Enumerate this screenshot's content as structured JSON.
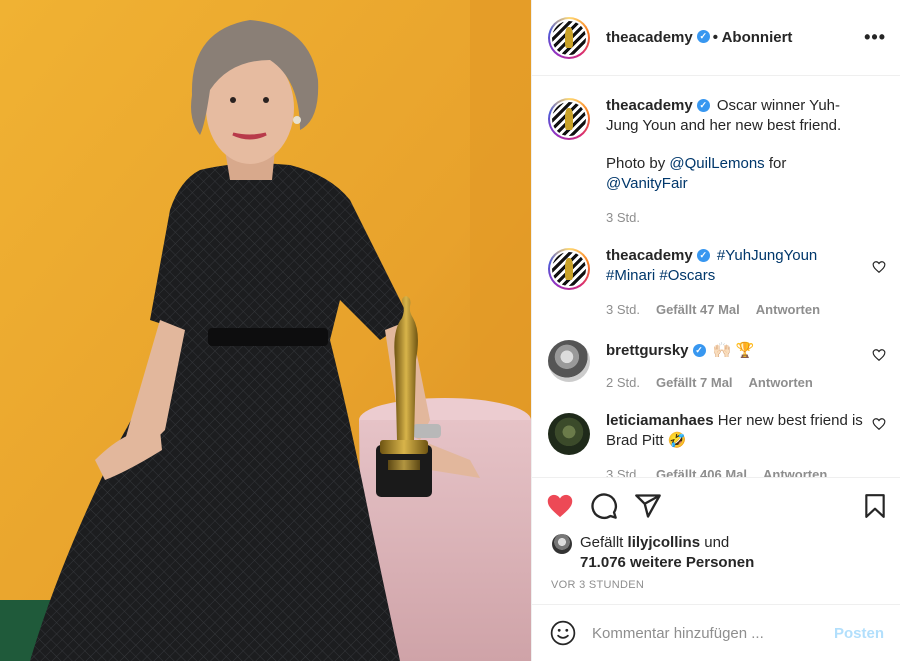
{
  "header": {
    "username": "theacademy",
    "follow_status": "• Abonniert",
    "more": "•••"
  },
  "caption": {
    "username": "theacademy",
    "text_1": "Oscar winner Yuh-Jung Youn and her new best friend.",
    "text_2_prefix": "Photo by ",
    "mention_1": "@QuilLemons",
    "text_2_mid": " for ",
    "mention_2": "@VanityFair",
    "time": "3 Std."
  },
  "comments": [
    {
      "username": "theacademy",
      "text": "#YuhJungYoun #Minari #Oscars",
      "time": "3 Std.",
      "likes": "Gefällt 47 Mal",
      "reply": "Antworten"
    },
    {
      "username": "brettgursky",
      "text": "🙌🏻 🏆",
      "time": "2 Std.",
      "likes": "Gefällt 7 Mal",
      "reply": "Antworten"
    },
    {
      "username": "leticiamanhaes",
      "text": "Her new best friend is Brad Pitt 🤣",
      "time": "3 Std.",
      "likes": "Gefällt 406 Mal",
      "reply": "Antworten"
    }
  ],
  "likes": {
    "prefix": "Gefällt",
    "user": "lilyjcollins",
    "mid": "und",
    "count": "71.076 weitere Personen"
  },
  "timestamp": "VOR 3 STUNDEN",
  "add_comment": {
    "placeholder": "Kommentar hinzufügen ...",
    "post_label": "Posten"
  },
  "colors": {
    "like_red": "#ed4956",
    "link_blue": "#00376b",
    "verified_blue": "#3897f0",
    "post_button_disabled": "#b2dffc",
    "photo_background": "#e9a62c"
  }
}
